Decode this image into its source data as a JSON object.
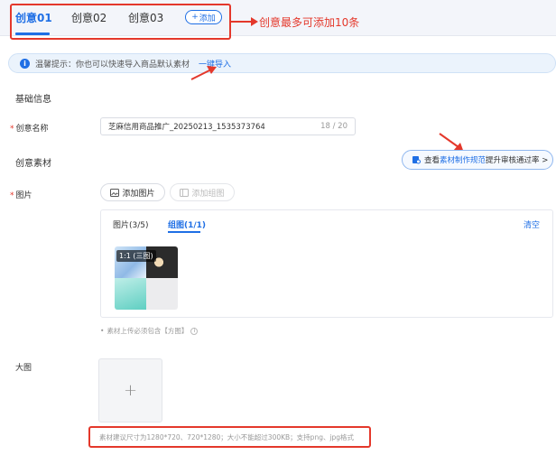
{
  "tabs": [
    {
      "label": "创意01",
      "active": true
    },
    {
      "label": "创意02",
      "active": false
    },
    {
      "label": "创意03",
      "active": false
    }
  ],
  "add_tab_label": "添加",
  "annotations": {
    "tabs_note": "创意最多可添加10条"
  },
  "tip": {
    "text": "温馨提示：你也可以快速导入商品默认素材",
    "link": "一键导入"
  },
  "sections": {
    "basic_info": "基础信息",
    "creative_material": "创意素材"
  },
  "fields": {
    "creative_name_label": "创意名称",
    "creative_name_value": "芝麻信用商品推广_20250213_1535373764",
    "creative_name_count": "18 / 20",
    "images_label": "图片",
    "big_image_label": "大图"
  },
  "spec_button": {
    "prefix": "查看",
    "highlight": "素材制作规范",
    "suffix": " 提升审核通过率 >"
  },
  "image_buttons": {
    "add_image": "添加图片",
    "add_group_image": "添加组图"
  },
  "material_panel": {
    "tabs": [
      {
        "label": "图片(3/5)",
        "active": false
      },
      {
        "label": "组图(1/1)",
        "active": true
      }
    ],
    "clear_label": "清空",
    "group_badge": "1:1 (三图)"
  },
  "hints": {
    "square_hint": "素材上传必须包含【方图】",
    "size_hint": "素材建议尺寸为1280*720、720*1280；大小不能超过300KB；支持png、jpg格式"
  },
  "colors": {
    "primary": "#1f6fe5",
    "annotation": "#e4382b",
    "required": "#e4382b"
  }
}
